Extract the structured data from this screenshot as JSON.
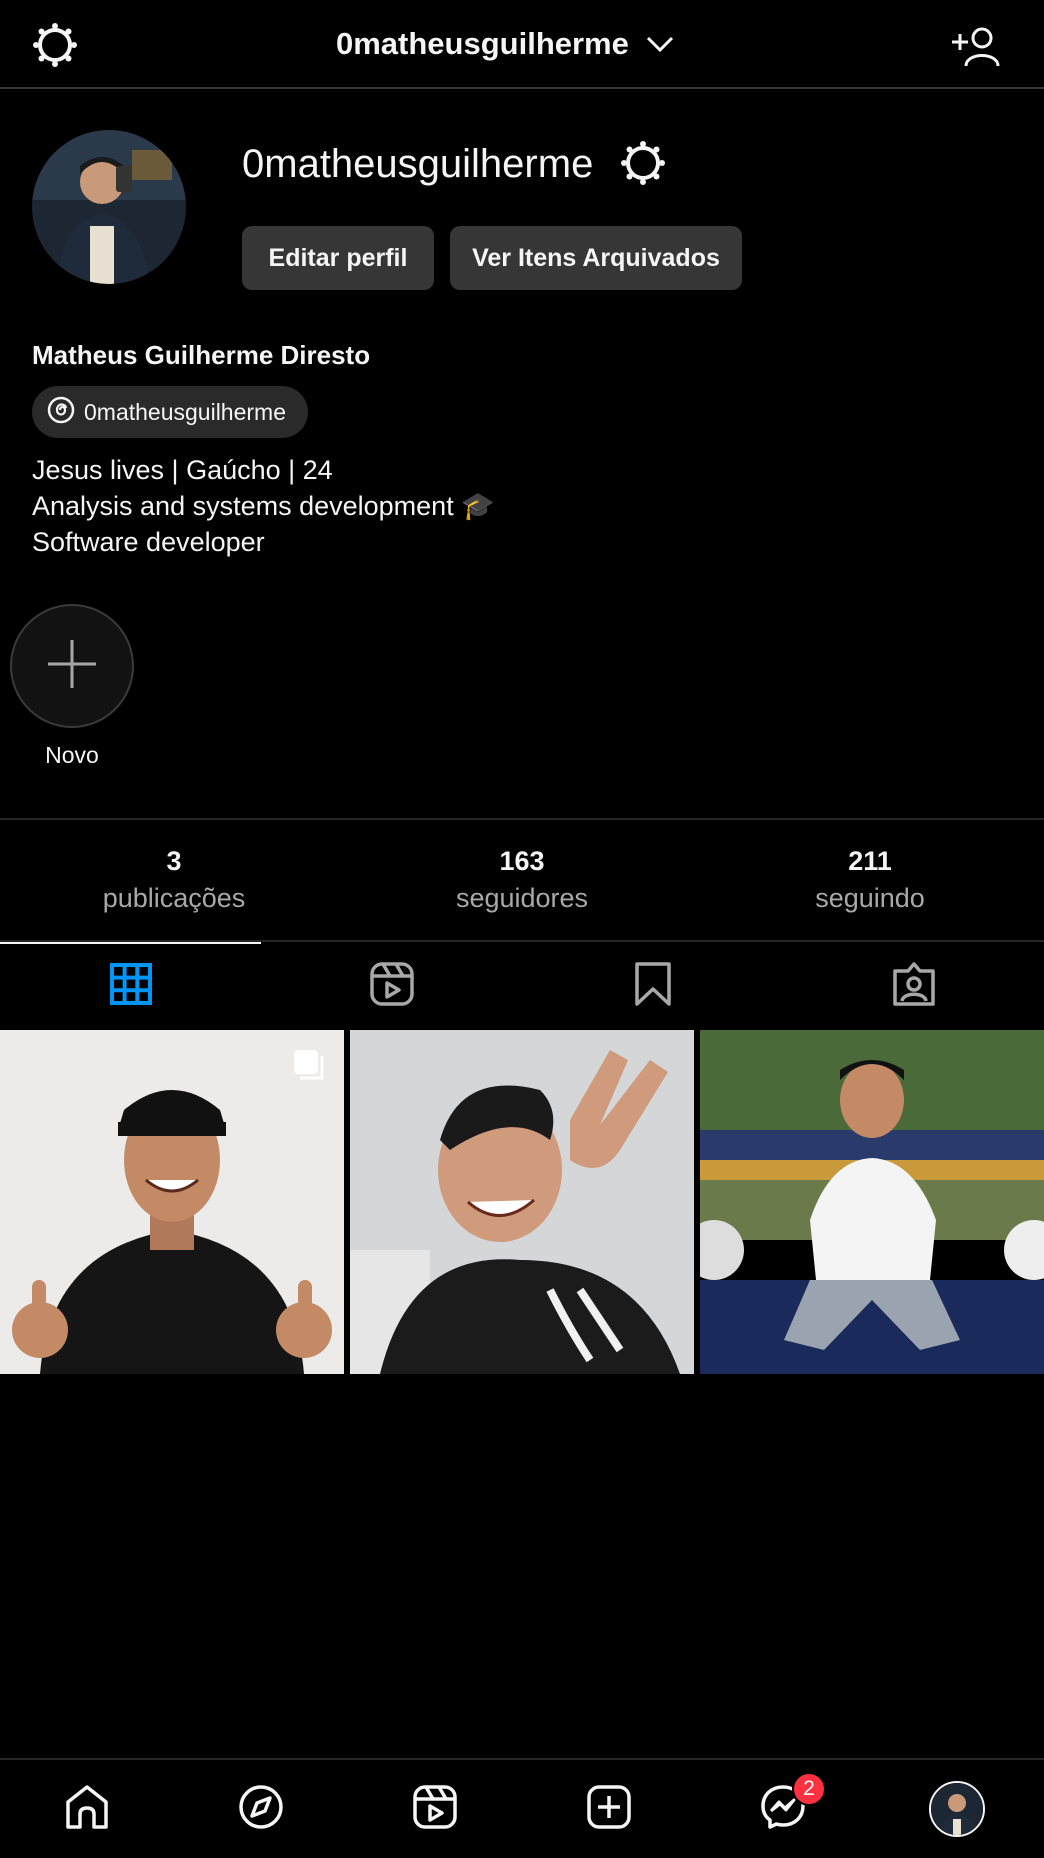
{
  "header": {
    "title": "0matheusguilherme",
    "left_icon": "threads-icon",
    "right_icon": "add-user-icon",
    "dropdown_icon": "chevron-down-icon"
  },
  "profile": {
    "username": "0matheusguilherme",
    "edit_button": "Editar perfil",
    "archive_button": "Ver Itens Arquivados",
    "full_name": "Matheus Guilherme Diresto",
    "threads_handle": "0matheusguilherme",
    "bio_lines": [
      "Jesus lives | Gaúcho | 24",
      "Analysis and systems development 🎓",
      "Software developer"
    ]
  },
  "highlights": [
    {
      "label": "Novo",
      "icon": "plus-icon"
    }
  ],
  "stats": [
    {
      "value": "3",
      "label": "publicações"
    },
    {
      "value": "163",
      "label": "seguidores"
    },
    {
      "value": "211",
      "label": "seguindo"
    }
  ],
  "tabs": [
    {
      "icon": "grid-icon",
      "active": true
    },
    {
      "icon": "reels-icon",
      "active": false
    },
    {
      "icon": "saved-icon",
      "active": false
    },
    {
      "icon": "tagged-icon",
      "active": false
    }
  ],
  "posts": [
    {
      "description": "photo",
      "multiple": true
    },
    {
      "description": "photo",
      "multiple": false
    },
    {
      "description": "photo",
      "multiple": false
    }
  ],
  "bottom_nav": [
    {
      "icon": "home-icon"
    },
    {
      "icon": "explore-icon"
    },
    {
      "icon": "reels-icon"
    },
    {
      "icon": "create-icon"
    },
    {
      "icon": "messenger-icon",
      "badge": "2"
    },
    {
      "icon": "profile-avatar"
    }
  ],
  "colors": {
    "background": "#000000",
    "text": "#f5f5f5",
    "secondary_text": "#a8a8a8",
    "button_bg": "#363636",
    "active_tab": "#0095f6",
    "badge": "#ff3040"
  }
}
